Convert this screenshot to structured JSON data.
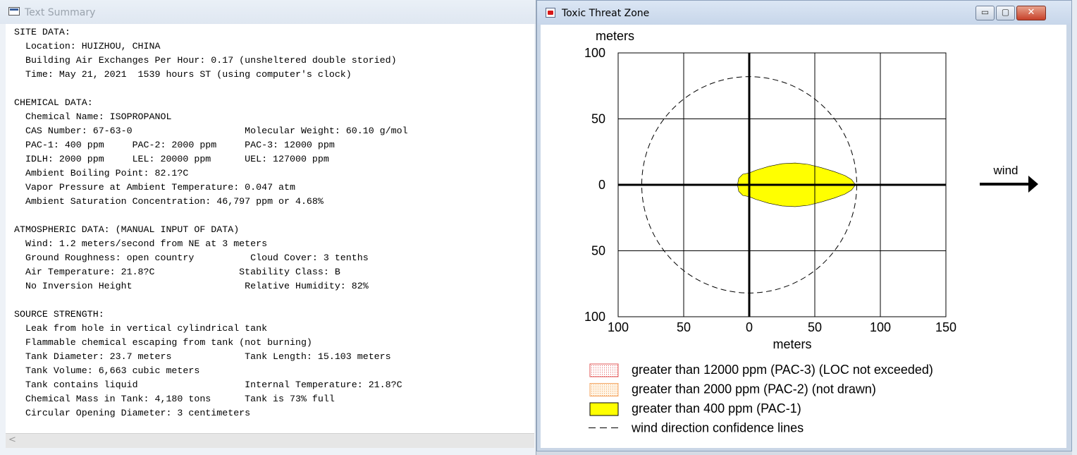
{
  "left_window": {
    "title": "Text Summary",
    "lines": [
      "SITE DATA:",
      "  Location: HUIZHOU, CHINA",
      "  Building Air Exchanges Per Hour: 0.17 (unsheltered double storied)",
      "  Time: May 21, 2021  1539 hours ST (using computer's clock)",
      "",
      "CHEMICAL DATA:",
      "  Chemical Name: ISOPROPANOL",
      "  CAS Number: 67-63-0                    Molecular Weight: 60.10 g/mol",
      "  PAC-1: 400 ppm     PAC-2: 2000 ppm     PAC-3: 12000 ppm",
      "  IDLH: 2000 ppm     LEL: 20000 ppm      UEL: 127000 ppm",
      "  Ambient Boiling Point: 82.1?C",
      "  Vapor Pressure at Ambient Temperature: 0.047 atm",
      "  Ambient Saturation Concentration: 46,797 ppm or 4.68%",
      "",
      "ATMOSPHERIC DATA: (MANUAL INPUT OF DATA)",
      "  Wind: 1.2 meters/second from NE at 3 meters",
      "  Ground Roughness: open country          Cloud Cover: 3 tenths",
      "  Air Temperature: 21.8?C               Stability Class: B",
      "  No Inversion Height                    Relative Humidity: 82%",
      "",
      "SOURCE STRENGTH:",
      "  Leak from hole in vertical cylindrical tank",
      "  Flammable chemical escaping from tank (not burning)",
      "  Tank Diameter: 23.7 meters             Tank Length: 15.103 meters",
      "  Tank Volume: 6,663 cubic meters",
      "  Tank contains liquid                   Internal Temperature: 21.8?C",
      "  Chemical Mass in Tank: 4,180 tons      Tank is 73% full",
      "  Circular Opening Diameter: 3 centimeters"
    ],
    "scroll_left_glyph": "<"
  },
  "right_window": {
    "title": "Toxic Threat Zone",
    "buttons": {
      "minimize": "▭",
      "maximize": "▢",
      "close": "✕"
    }
  },
  "chart_data": {
    "type": "area",
    "title": "",
    "xlabel": "meters",
    "ylabel": "meters",
    "xlim": [
      -100,
      150
    ],
    "ylim": [
      -100,
      100
    ],
    "x_ticks": [
      {
        "value": -100,
        "label": "100"
      },
      {
        "value": -50,
        "label": "50"
      },
      {
        "value": 0,
        "label": "0"
      },
      {
        "value": 50,
        "label": "50"
      },
      {
        "value": 100,
        "label": "100"
      },
      {
        "value": 150,
        "label": "150"
      }
    ],
    "y_ticks": [
      {
        "value": 100,
        "label": "100"
      },
      {
        "value": 50,
        "label": "50"
      },
      {
        "value": 0,
        "label": "0"
      },
      {
        "value": -50,
        "label": "50"
      },
      {
        "value": -100,
        "label": "100"
      }
    ],
    "grid": true,
    "wind_label": "wind",
    "confidence_circle_radius": 82,
    "threat_zone": {
      "color": "#ffff00",
      "points": [
        [
          -9,
          0
        ],
        [
          -8,
          5
        ],
        [
          -5,
          8
        ],
        [
          0,
          9
        ],
        [
          5,
          11
        ],
        [
          15,
          14
        ],
        [
          25,
          16
        ],
        [
          35,
          16.5
        ],
        [
          45,
          15.5
        ],
        [
          55,
          13
        ],
        [
          65,
          10
        ],
        [
          73,
          7
        ],
        [
          78,
          4
        ],
        [
          81,
          0
        ],
        [
          78,
          -4
        ],
        [
          73,
          -7
        ],
        [
          65,
          -10
        ],
        [
          55,
          -13
        ],
        [
          45,
          -15.5
        ],
        [
          35,
          -16.5
        ],
        [
          25,
          -16
        ],
        [
          15,
          -14
        ],
        [
          5,
          -11
        ],
        [
          0,
          -9
        ],
        [
          -5,
          -8
        ],
        [
          -8,
          -5
        ]
      ]
    },
    "legend": [
      {
        "label": "greater than 12000 ppm (PAC-3) (LOC not exceeded)",
        "swatch": "pac3"
      },
      {
        "label": "greater than 2000 ppm (PAC-2) (not drawn)",
        "swatch": "pac2"
      },
      {
        "label": "greater than 400 ppm (PAC-1)",
        "swatch": "pac1"
      },
      {
        "label": "wind direction confidence lines",
        "swatch": "dash"
      }
    ],
    "legend_placement": "bottom-left",
    "colors": {
      "pac1": "#ffff00",
      "pac2": "#f4a460",
      "pac3": "#e05050"
    }
  }
}
